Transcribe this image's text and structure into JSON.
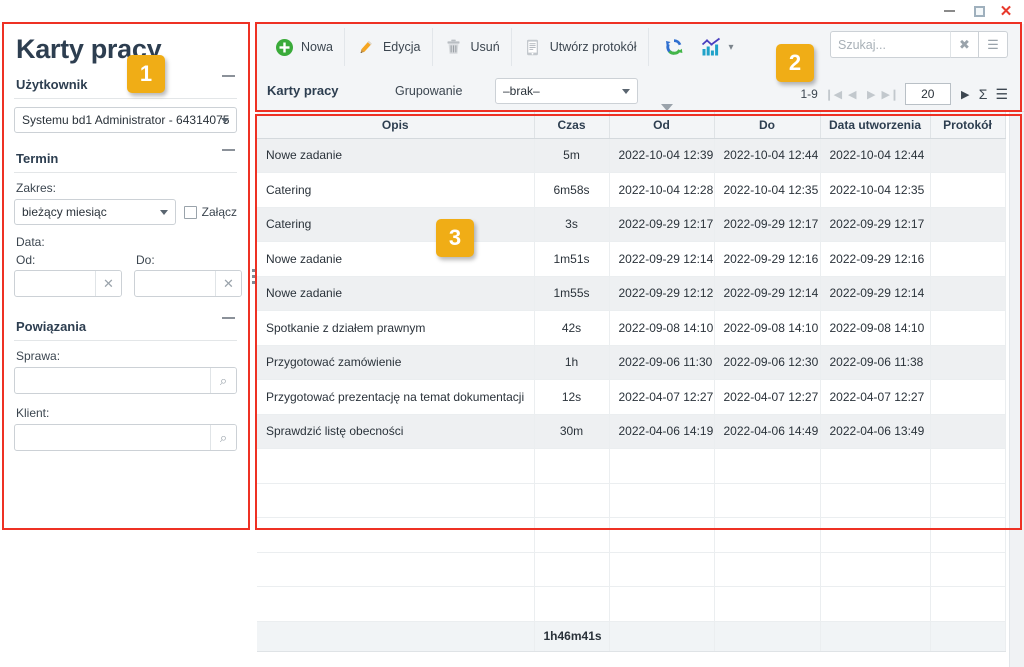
{
  "window": {
    "minimize_label": "–",
    "maximize_label": "□",
    "close_label": "✕"
  },
  "sidebar": {
    "title": "Karty pracy",
    "sections": [
      {
        "heading": "Użytkownik"
      },
      {
        "heading": "Termin"
      },
      {
        "heading": "Powiązania"
      }
    ],
    "user_select_value": "Systemu bd1 Administrator - 64314075",
    "zakres_label": "Zakres:",
    "zakres_value": "bieżący miesiąc",
    "zalacz_label": "Załącz",
    "data_label": "Data:",
    "od_label": "Od:",
    "do_label": "Do:",
    "od_value": "",
    "do_value": "",
    "sprawa_label": "Sprawa:",
    "sprawa_value": "",
    "klient_label": "Klient:",
    "klient_value": "",
    "clear_glyph": "✕",
    "search_glyph": "⌕"
  },
  "toolbar": {
    "buttons": [
      {
        "label": "Nowa",
        "icon": "plus-circle-icon"
      },
      {
        "label": "Edycja",
        "icon": "pencil-icon"
      },
      {
        "label": "Usuń",
        "icon": "trash-icon"
      },
      {
        "label": "Utwórz protokół",
        "icon": "document-icon"
      }
    ],
    "refresh_icon": "refresh-icon",
    "chart_icon": "chart-icon",
    "chart_caret": "▾",
    "module_label": "Karty pracy",
    "grouping_label": "Grupowanie",
    "grouping_value": "–brak–",
    "search_placeholder": "Szukaj...",
    "search_value": "",
    "search_clear_glyph": "✖",
    "search_menu_glyph": "☰"
  },
  "pager": {
    "range": "1-9",
    "first_glyph": "❙◀",
    "prev_glyph": "◀",
    "next_glyph": "▶",
    "last_glyph": "▶❙",
    "page_size": "20",
    "go_glyph": "▶",
    "sum_glyph": "Σ",
    "menu_glyph": "☰"
  },
  "grid": {
    "columns": [
      "Opis",
      "Czas",
      "Od",
      "Do",
      "Data utworzenia",
      "Protokół"
    ],
    "rows": [
      {
        "opis": "Nowe zadanie",
        "czas": "5m",
        "od": "2022-10-04 12:39",
        "do": "2022-10-04 12:44",
        "utworzenia": "2022-10-04 12:44",
        "protokol": ""
      },
      {
        "opis": "Catering",
        "czas": "6m58s",
        "od": "2022-10-04 12:28",
        "do": "2022-10-04 12:35",
        "utworzenia": "2022-10-04 12:35",
        "protokol": ""
      },
      {
        "opis": "Catering",
        "czas": "3s",
        "od": "2022-09-29 12:17",
        "do": "2022-09-29 12:17",
        "utworzenia": "2022-09-29 12:17",
        "protokol": ""
      },
      {
        "opis": "Nowe zadanie",
        "czas": "1m51s",
        "od": "2022-09-29 12:14",
        "do": "2022-09-29 12:16",
        "utworzenia": "2022-09-29 12:16",
        "protokol": ""
      },
      {
        "opis": "Nowe zadanie",
        "czas": "1m55s",
        "od": "2022-09-29 12:12",
        "do": "2022-09-29 12:14",
        "utworzenia": "2022-09-29 12:14",
        "protokol": ""
      },
      {
        "opis": "Spotkanie z działem prawnym",
        "czas": "42s",
        "od": "2022-09-08 14:10",
        "do": "2022-09-08 14:10",
        "utworzenia": "2022-09-08 14:10",
        "protokol": ""
      },
      {
        "opis": "Przygotować zamówienie",
        "czas": "1h",
        "od": "2022-09-06 11:30",
        "do": "2022-09-06 12:30",
        "utworzenia": "2022-09-06 11:38",
        "protokol": ""
      },
      {
        "opis": "Przygotować prezentację na temat dokumentacji",
        "czas": "12s",
        "od": "2022-04-07 12:27",
        "do": "2022-04-07 12:27",
        "utworzenia": "2022-04-07 12:27",
        "protokol": ""
      },
      {
        "opis": "Sprawdzić listę obecności",
        "czas": "30m",
        "od": "2022-04-06 14:19",
        "do": "2022-04-06 14:49",
        "utworzenia": "2022-04-06 13:49",
        "protokol": ""
      }
    ],
    "empty_row_count": 5,
    "summary": {
      "opis": "",
      "czas": "1h46m41s",
      "od": "",
      "do": "",
      "utworzenia": "",
      "protokol": ""
    }
  },
  "annotations": {
    "badge1": "1",
    "badge2": "2",
    "badge3": "3",
    "color": "#ee3124",
    "badge_color": "#f0ad16"
  }
}
